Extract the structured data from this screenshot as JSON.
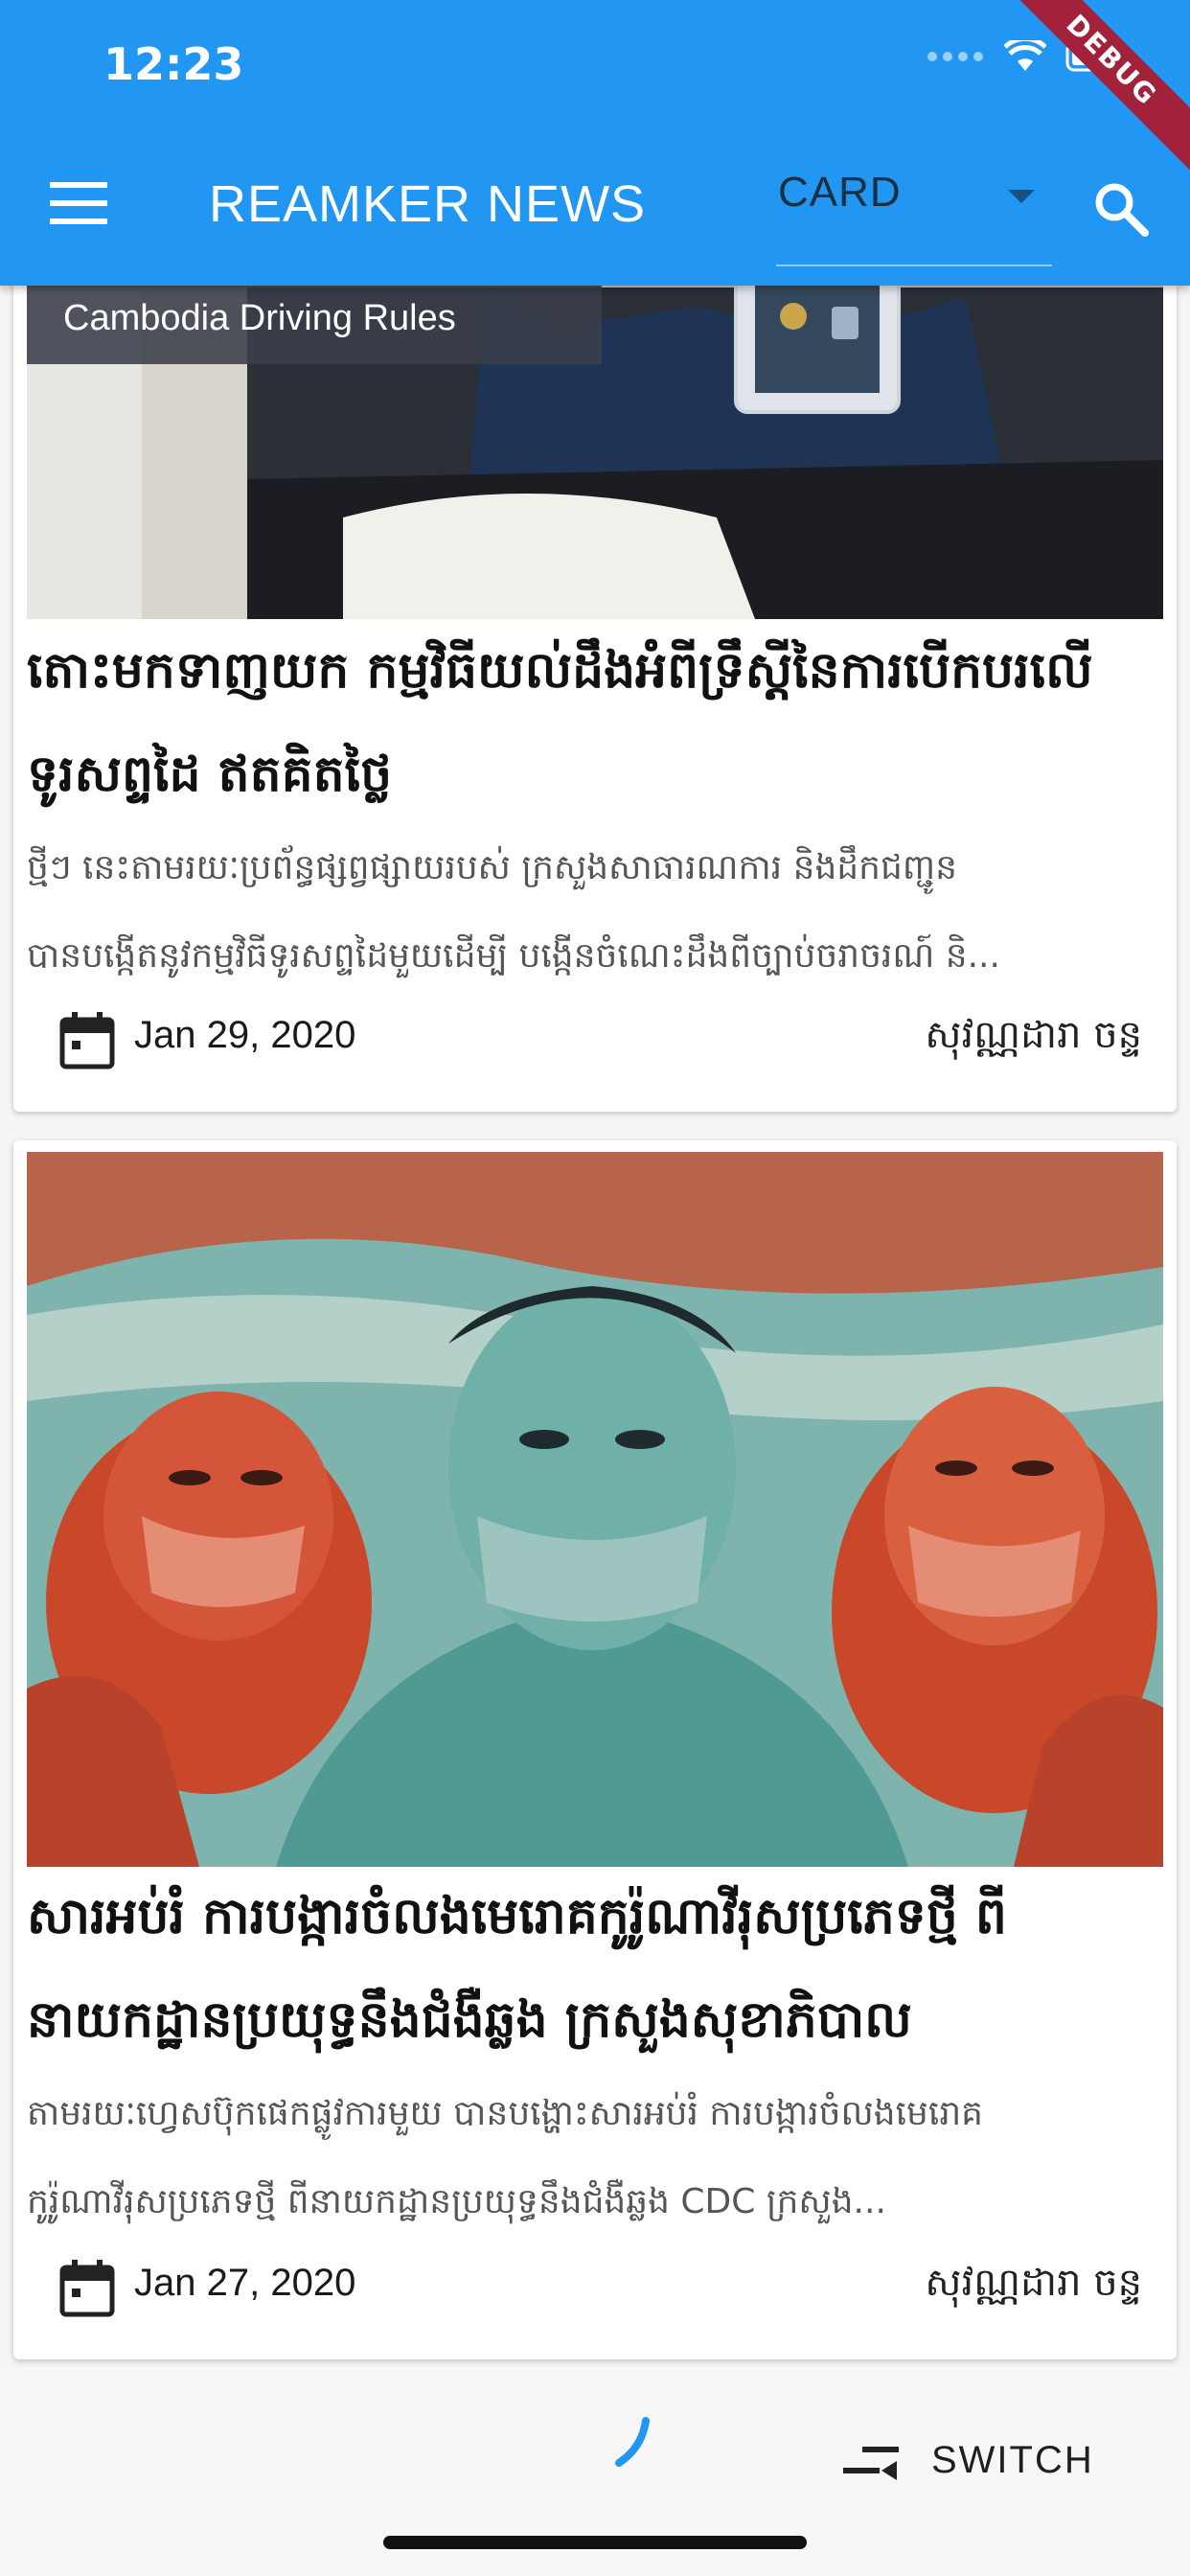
{
  "status_bar": {
    "time": "12:23",
    "debug_label": "DEBUG"
  },
  "app_bar": {
    "title": "REAMKER NEWS",
    "view_mode": "CARD",
    "icons": {
      "menu": "menu-icon",
      "search": "search-icon",
      "dropdown": "chevron-down-icon"
    }
  },
  "articles": [
    {
      "image_caption": "Cambodia Driving Rules",
      "title_lines": [
        "តោះមកទាញយក កម្មវិធីយល់ដឹងអំពីទ្រឹស្តីនៃការបើកបរលើ",
        "ទូរសព្ទដៃ ឥតគិតថ្លៃ"
      ],
      "description_lines": [
        "ថ្មីៗ នេះតាមរយៈប្រព័ន្ធផ្សព្វផ្សាយរបស់ ក្រសួងសាធារណការ និងដឹកជញ្ជូន",
        "បានបង្កើតនូវកម្មវិធីទូរសព្ទដៃមួយដើម្បី បង្កើនចំណេះដឹងពីច្បាប់ចរាចរណ៍ និ..."
      ],
      "date": "Jan 29, 2020",
      "author": "សុវណ្ណដារា ចន្ទ"
    },
    {
      "image_caption": "",
      "title_lines": [
        "សារអប់រំ ការបង្ការចំលងមេរោគកូរ៉ូណាវីរុសប្រភេទថ្មី ពី",
        "នាយកដ្ឋានប្រយុទ្ធនឹងជំងឺឆ្លង ក្រសួងសុខាភិបាល"
      ],
      "description_lines": [
        "តាមរយៈហ្វេសប៊ុកផេកផ្លូវការមួយ បានបង្ហោះសារអប់រំ ការបង្ការចំលងមេរោគ",
        "កូរ៉ូណាវីរុសប្រភេទថ្មី ពីនាយកដ្ឋានប្រយុទ្ធនឹងជំងឺឆ្លង CDC ក្រសួង..."
      ],
      "date": "Jan 27, 2020",
      "author": "សុវណ្ណដារា ចន្ទ"
    }
  ],
  "bottom": {
    "switch_label": "SWITCH"
  },
  "colors": {
    "primary": "#2196f3",
    "debug": "#a3223b",
    "loader": "#2196f3"
  }
}
